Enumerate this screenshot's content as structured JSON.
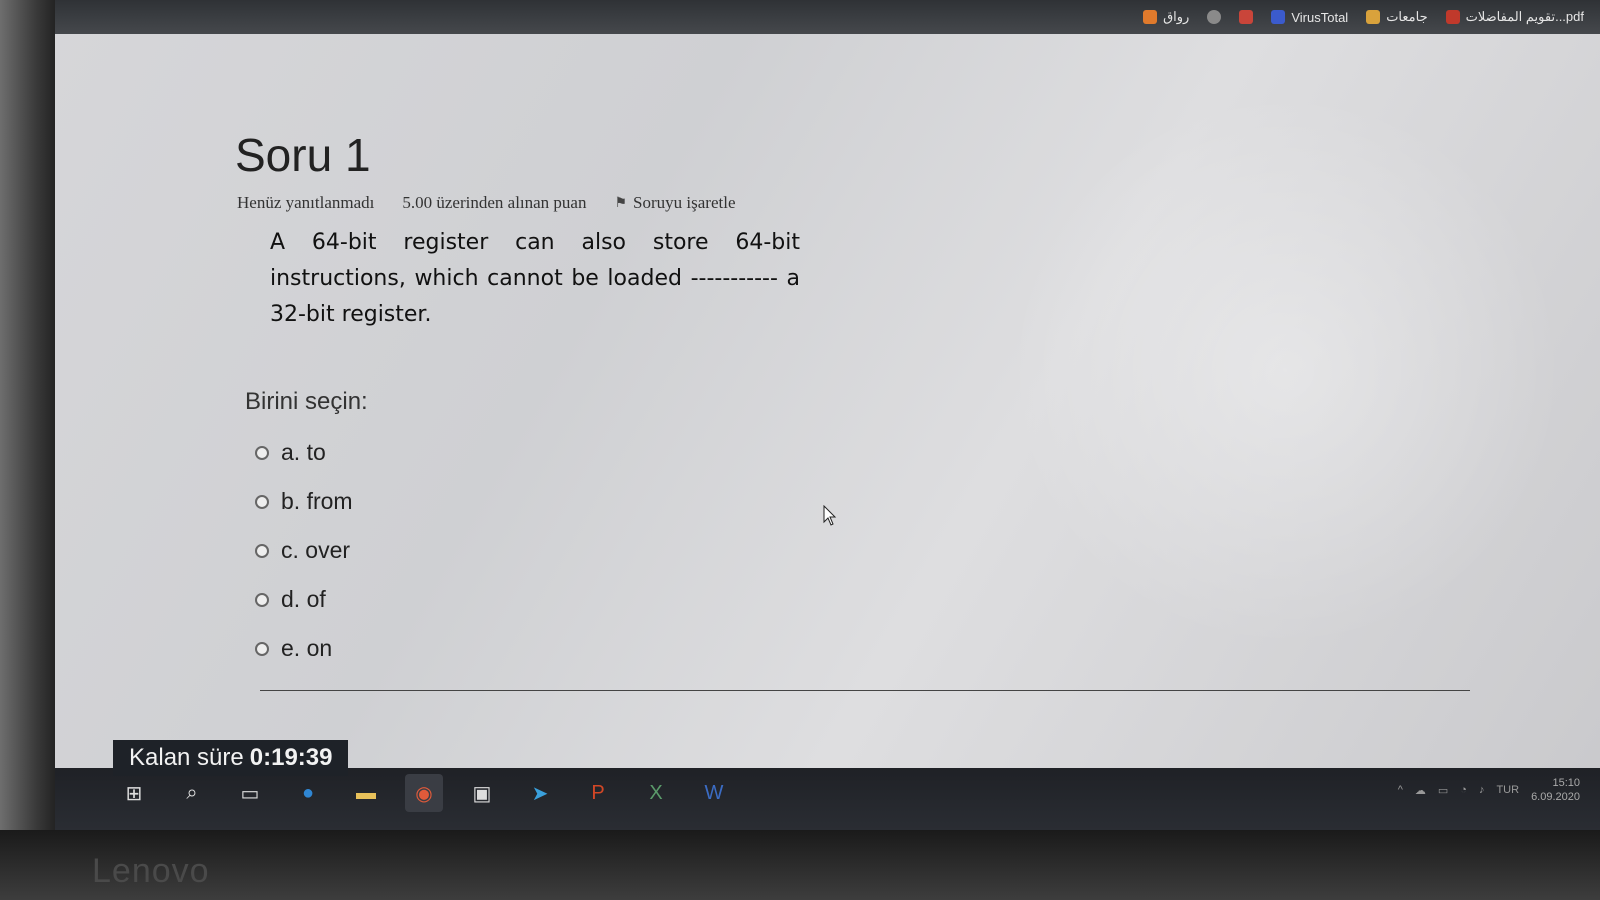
{
  "bookmarks": [
    {
      "label": "رواق",
      "color": "#e07a2c"
    },
    {
      "label": "",
      "color": "#8a8a8a"
    },
    {
      "label": "",
      "color": "#c9453a"
    },
    {
      "label": "VirusTotal",
      "color": "#3b5bcc"
    },
    {
      "label": "جامعات",
      "color": "#d9a23c"
    },
    {
      "label": "تقويم المفاضلات...pdf",
      "color": "#c0392b"
    }
  ],
  "question": {
    "title": "Soru 1",
    "status": "Henüz yanıtlanmadı",
    "points": "5.00 üzerinden alınan puan",
    "flag_label": "Soruyu işaretle",
    "text": "A 64-bit register can also store 64-bit instructions, which cannot be loaded ----------- a 32-bit register.",
    "prompt": "Birini seçin:",
    "options": [
      "a. to",
      "b. from",
      "c. over",
      "d. of",
      "e. on"
    ]
  },
  "timer": {
    "label": "Kalan süre",
    "value": "0:19:39"
  },
  "taskbar": {
    "icons": [
      "windows-start-icon",
      "search-icon",
      "task-view-icon",
      "edge-icon",
      "file-explorer-icon",
      "chrome-icon",
      "store-icon",
      "telegram-icon",
      "powerpoint-icon",
      "excel-icon",
      "word-icon"
    ],
    "tray_lang": "TUR",
    "time": "15:10",
    "date": "6.09.2020"
  },
  "laptop_brand": "Lenovo"
}
